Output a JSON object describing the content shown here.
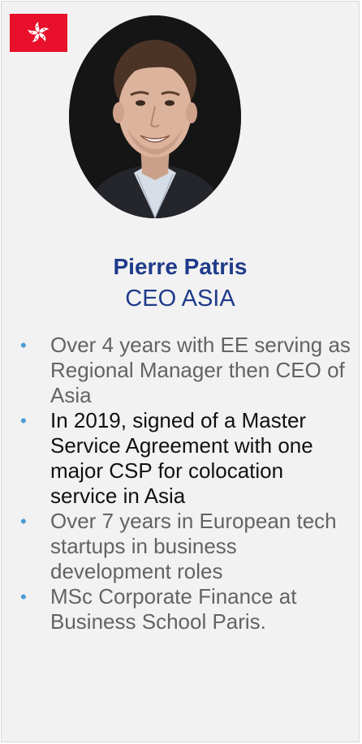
{
  "profile": {
    "flag_icon": "hong-kong-flag-icon",
    "name": "Pierre Patris",
    "title": "CEO ASIA"
  },
  "bullets": [
    {
      "text": "Over 4 years with EE serving as Regional Manager then CEO of Asia"
    },
    {
      "text": "In 2019, signed of a Master Service Agreement with one major CSP for colocation service in Asia"
    },
    {
      "text": "Over 7 years in European tech startups in business development roles"
    },
    {
      "text": "MSc Corporate Finance at Business School Paris."
    }
  ],
  "colors": {
    "accent": "#1f3b8a",
    "bullet": "#4a9bd8",
    "flag": "#e8102a",
    "background": "#f2f2f2"
  }
}
